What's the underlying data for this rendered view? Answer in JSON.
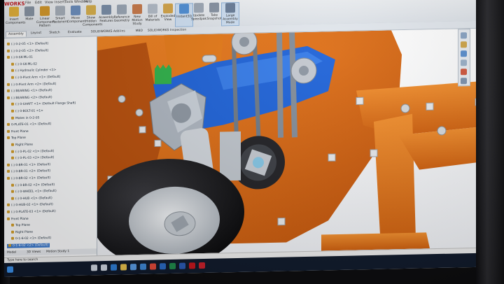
{
  "app": {
    "logo": "WORKS",
    "accent": "#c4161c"
  },
  "menu": [
    "File",
    "Edit",
    "View",
    "Insert",
    "Tools",
    "Window",
    "Help"
  ],
  "ribbon": {
    "buttons": [
      {
        "label": "Insert Components",
        "icon": "insert-component-icon",
        "color": "#e7b43a"
      },
      {
        "label": "Mate",
        "icon": "mate-icon",
        "color": "#8a96a6"
      },
      {
        "label": "Linear Component Pattern",
        "icon": "pattern-icon",
        "color": "#d79a2b"
      },
      {
        "label": "Smart Fasteners",
        "icon": "fastener-icon",
        "color": "#a7b0bb"
      },
      {
        "label": "Move Component",
        "icon": "move-icon",
        "color": "#6c8fbf"
      },
      {
        "label": "Show Hidden Components",
        "icon": "show-hidden-icon",
        "color": "#d9b04a"
      },
      {
        "label": "Assembly Features",
        "icon": "assembly-features-icon",
        "color": "#7a8ea8"
      },
      {
        "label": "Reference Geometry",
        "icon": "reference-geometry-icon",
        "color": "#9aa6b5"
      },
      {
        "label": "New Motion Study",
        "icon": "motion-study-icon",
        "color": "#c97a4a"
      },
      {
        "label": "Bill of Materials",
        "icon": "bom-icon",
        "color": "#b3bcc8"
      },
      {
        "label": "Exploded View",
        "icon": "exploded-view-icon",
        "color": "#d5a548"
      },
      {
        "label": "Instant3D",
        "icon": "instant3d-icon",
        "color": "#4f8fd6",
        "active": true
      },
      {
        "label": "Update Speedpak",
        "icon": "speedpak-icon",
        "color": "#9fa9b6"
      },
      {
        "label": "Take Snapshot",
        "icon": "snapshot-icon",
        "color": "#8793a3"
      },
      {
        "label": "Large Assembly Mode",
        "icon": "large-assembly-icon",
        "color": "#6a7e99",
        "active": true
      }
    ]
  },
  "doc_tabs": [
    "Assembly",
    "Layout",
    "Sketch",
    "Evaluate",
    "SOLIDWORKS Add-Ins",
    "MBD",
    "SOLIDWORKS Inspection"
  ],
  "tree": {
    "items": [
      "(-) 0-2-05 <1> (Default)",
      "(-) 0-2-05 <2> (Default)",
      "(-) 0-SK-ML-01",
      "(-) 0-SK-ML-02",
      "(-) Hydraulic Cylinder <1>",
      "(-) 0-Pivot Arm <1> (Default)",
      "(-) 0-Pivot Arm <2> (Default)",
      "(-) BEARING <1> (Default)",
      "(-) BEARING <2> (Default)",
      "(-) 0-SHAFT <1> (Default Flange Shaft)",
      "(-) 0-BOLT-01 <1>",
      "Mates in 0-2-05",
      "0-PLATE-01 <1> (Default)",
      "Front Plane",
      "Top Plane",
      "Right Plane",
      "(-) 0-PL-02 <1> (Default)",
      "(-) 0-PL-03 <2> (Default)",
      "(-) 0-BR-01 <1> (Default)",
      "(-) 0-BR-01 <2> (Default)",
      "(-) 0-BR-02 <1> (Default)",
      "(-) 0-BR-02 <2> (Default)",
      "(-) 0-WHEEL <1> (Default)",
      "(-) 0-HUB <1> (Default)",
      "(-) 0-HUB-02 <1> (Default)",
      "(-) 0-PLATE-03 <1> (Default)",
      "Front Plane",
      "Top Plane",
      "Right Plane",
      "0-1-6-02 <1> (Default)",
      "0-1-6-02 <2> (Default)"
    ],
    "selected": "0-1-6-02 <2> (Default)",
    "bottom_tabs": [
      "Model",
      "3D Views",
      "Motion Study 1"
    ]
  },
  "status": {
    "text": "Type here to search"
  },
  "colors": {
    "part_orange": "#e06a0a",
    "part_blue": "#1f63d8",
    "tire": "#1c1c1f",
    "rim": "#d7dbe0"
  },
  "taskbar_icons": [
    {
      "name": "start-icon",
      "color": "#3b8fe8"
    },
    {
      "name": "search-icon",
      "color": "#cfd6e0"
    },
    {
      "name": "task-view-icon",
      "color": "#cfd6e0"
    },
    {
      "name": "edge-icon",
      "color": "#2f7fd8"
    },
    {
      "name": "explorer-icon",
      "color": "#e9c34d"
    },
    {
      "name": "store-icon",
      "color": "#5a9de6"
    },
    {
      "name": "mail-icon",
      "color": "#3f88d6"
    },
    {
      "name": "chrome-icon",
      "color": "#e24a3a"
    },
    {
      "name": "outlook-icon",
      "color": "#2a6bc4"
    },
    {
      "name": "excel-icon",
      "color": "#1f8a4b"
    },
    {
      "name": "word-icon",
      "color": "#2a5ab4"
    },
    {
      "name": "solidworks-icon",
      "color": "#c4161c"
    },
    {
      "name": "acrobat-icon",
      "color": "#c8202a"
    }
  ]
}
